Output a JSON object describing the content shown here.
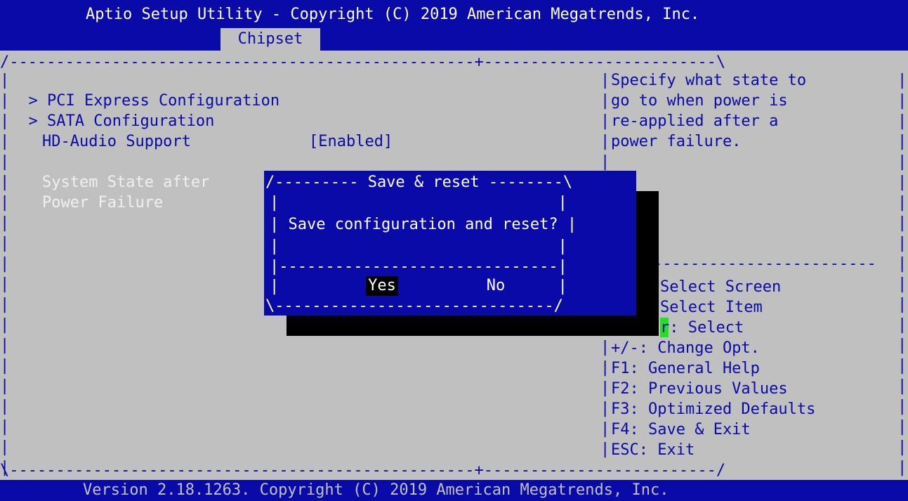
{
  "header": {
    "title": "Aptio Setup Utility - Copyright (C) 2019 American Megatrends, Inc.",
    "active_tab": "Chipset"
  },
  "frame": {
    "top_left": "/--------------------------------------------------+-------------------------\\",
    "bottom": "\\--------------------------------------------------+-------------------------/"
  },
  "menu": {
    "items": [
      {
        "prefix": ">",
        "label": "PCI Express Configuration"
      },
      {
        "prefix": ">",
        "label": "SATA Configuration"
      }
    ],
    "hd_audio": {
      "label": "HD-Audio Support",
      "value": "[Enabled]"
    },
    "system_state": {
      "label_line1": "System State after",
      "label_line2": "Power Failure"
    }
  },
  "help": {
    "lines": [
      "Specify what state to",
      "go to when power is",
      "re-applied after a",
      "power failure."
    ]
  },
  "keys": {
    "lines": [
      "Select Screen",
      "Select Item",
      "r: Select",
      "+/-: Change Opt.",
      "F1: General Help",
      "F2: Previous Values",
      "F3: Optimized Defaults",
      "F4: Save & Exit",
      "ESC: Exit"
    ]
  },
  "dialog": {
    "title_line": "/--------- Save & reset --------\\",
    "question": "Save configuration and reset?",
    "separator": "|------------------------------|",
    "bottom": "\\------------------------------/",
    "yes": "Yes",
    "no": "No"
  },
  "footer": {
    "text": "Version 2.18.1263. Copyright (C) 2019 American Megatrends, Inc."
  },
  "colors": {
    "bios_blue": "#0a0aa8",
    "bios_grey": "#c0c0c0",
    "enter_highlight": "#22e022"
  }
}
